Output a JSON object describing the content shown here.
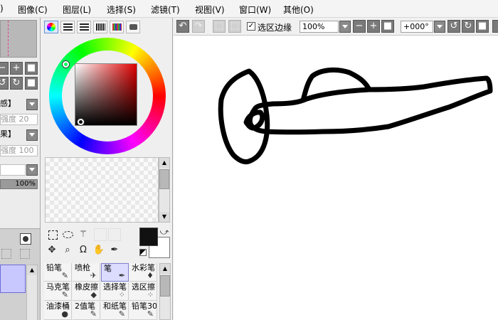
{
  "menu": {
    "items": [
      "图像(C)",
      "图层(L)",
      "选择(S)",
      "滤镜(T)",
      "视图(V)",
      "窗口(W)",
      "其他(O)"
    ],
    "fragment": ")"
  },
  "left_panel": {
    "select1": "感】",
    "field1": "强度 20",
    "select2": "果】",
    "field2": "强度 100",
    "opacity": "100%"
  },
  "color_panel": {
    "hue_color": "#e00000",
    "main_color": "#111111",
    "sub_color": "#ffffff"
  },
  "brushes": [
    {
      "label": "铅笔",
      "icon": "✎",
      "selected": false
    },
    {
      "label": "喷枪",
      "icon": "✈",
      "selected": false
    },
    {
      "label": "笔",
      "icon": "✒",
      "selected": true
    },
    {
      "label": "水彩笔",
      "icon": "♦",
      "selected": false
    },
    {
      "label": "马克笔",
      "icon": "✎",
      "selected": false
    },
    {
      "label": "橡皮擦",
      "icon": "◆",
      "selected": false
    },
    {
      "label": "选择笔",
      "icon": "⁘",
      "selected": false
    },
    {
      "label": "选区擦",
      "icon": "⁘",
      "selected": false
    },
    {
      "label": "油漆桶",
      "icon": "●",
      "selected": false
    },
    {
      "label": "2值笔",
      "icon": "✎",
      "selected": false
    },
    {
      "label": "和纸笔",
      "icon": "✎",
      "selected": false
    },
    {
      "label": "铅笔30",
      "icon": "✎",
      "selected": false
    }
  ],
  "toolbar": {
    "selection_edge_label": "选区边缘",
    "selection_edge_checked": true,
    "zoom": "100%",
    "rotation": "+000°"
  }
}
